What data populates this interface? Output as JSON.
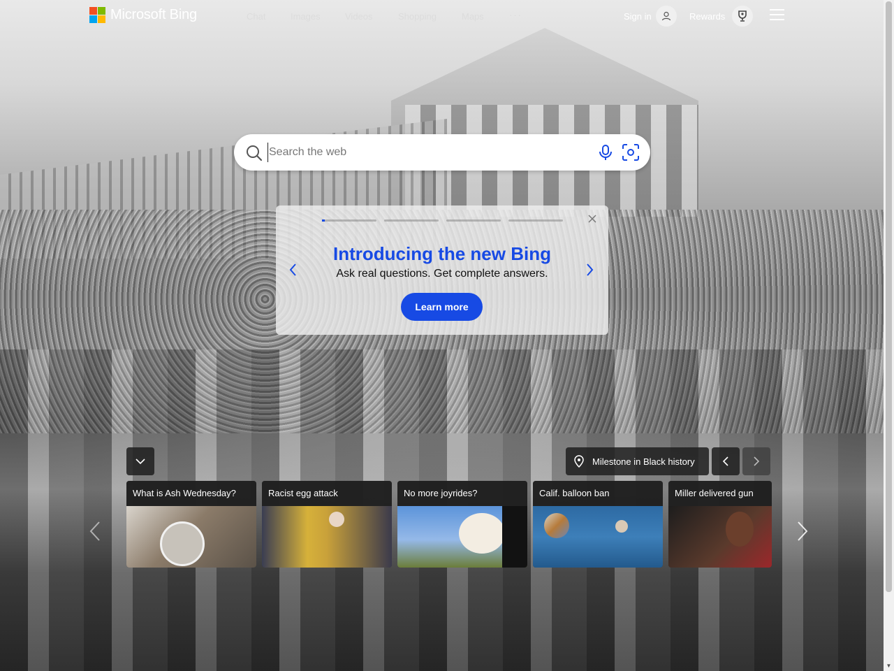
{
  "brand": {
    "name": "Microsoft Bing",
    "colors": [
      "#f25022",
      "#7fba00",
      "#00a4ef",
      "#ffb900"
    ]
  },
  "nav": {
    "items": [
      {
        "label": "Chat"
      },
      {
        "label": "Images"
      },
      {
        "label": "Videos"
      },
      {
        "label": "Shopping"
      },
      {
        "label": "Maps"
      },
      {
        "label": "···"
      }
    ]
  },
  "account": {
    "signin_label": "Sign in",
    "rewards_label": "Rewards"
  },
  "search": {
    "placeholder": "Search the web",
    "value": ""
  },
  "promo": {
    "title": "Introducing the new Bing",
    "subtitle": "Ask real questions. Get complete answers.",
    "button_label": "Learn more",
    "slides": 4,
    "active_slide": 1,
    "accent": "#174ae4"
  },
  "image_info": {
    "caption": "Milestone in Black history"
  },
  "news": {
    "cards": [
      {
        "title": "What is Ash Wednesday?"
      },
      {
        "title": "Racist egg attack"
      },
      {
        "title": "No more joyrides?"
      },
      {
        "title": "Calif. balloon ban"
      },
      {
        "title": "Miller delivered gun"
      }
    ]
  }
}
